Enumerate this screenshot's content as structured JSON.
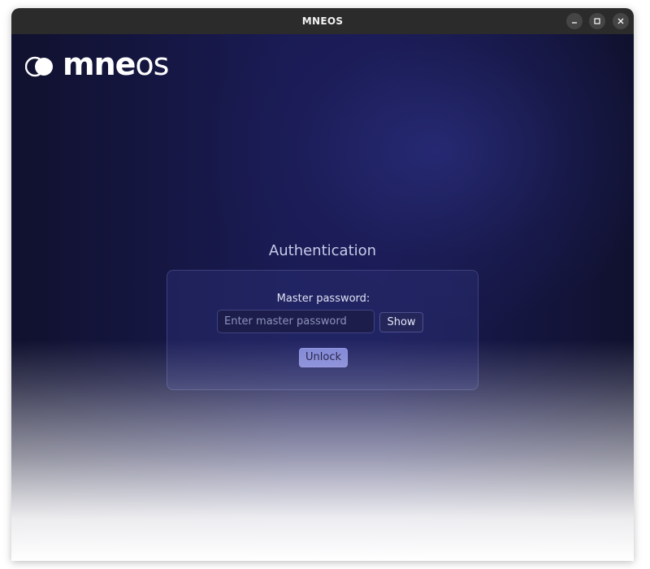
{
  "window": {
    "title": "MNEOS"
  },
  "logo": {
    "bold_text": "mne",
    "light_text": "os",
    "icon": "overlapping-circles-icon"
  },
  "auth": {
    "title": "Authentication",
    "password_label": "Master password:",
    "password_value": "",
    "password_placeholder": "Enter master password",
    "show_label": "Show",
    "unlock_label": "Unlock"
  },
  "colors": {
    "titlebar": "#2b2b2b",
    "background": "#1a1b54",
    "accent": "#8186d6"
  }
}
